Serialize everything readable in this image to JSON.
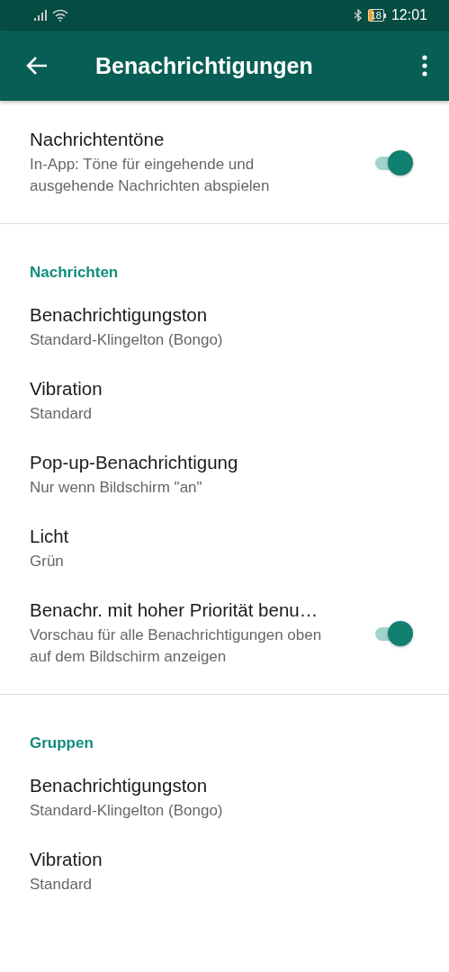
{
  "status_bar": {
    "time": "12:01",
    "battery": "18"
  },
  "app_bar": {
    "title": "Benachrichtigungen"
  },
  "sections": [
    {
      "items": [
        {
          "kind": "toggle",
          "title": "Nachrichtentöne",
          "subtitle": "In-App: Töne für eingehende und ausgehende Nachrichten abspielen",
          "on": true
        }
      ]
    },
    {
      "header": "Nachrichten",
      "items": [
        {
          "kind": "option",
          "title": "Benachrichtigungston",
          "subtitle": "Standard-Klingelton (Bongo)"
        },
        {
          "kind": "option",
          "title": "Vibration",
          "subtitle": "Standard"
        },
        {
          "kind": "option",
          "title": "Pop-up-Benachrichtigung",
          "subtitle": "Nur wenn Bildschirm \"an\""
        },
        {
          "kind": "option",
          "title": "Licht",
          "subtitle": "Grün"
        },
        {
          "kind": "toggle",
          "title": "Benachr. mit hoher Priorität benu…",
          "subtitle": "Vorschau für alle Benachrichtigungen oben auf dem Bildschirm anzeigen",
          "on": true
        }
      ]
    },
    {
      "header": "Gruppen",
      "items": [
        {
          "kind": "option",
          "title": "Benachrichtigungston",
          "subtitle": "Standard-Klingelton (Bongo)"
        },
        {
          "kind": "option",
          "title": "Vibration",
          "subtitle": "Standard"
        }
      ]
    }
  ]
}
